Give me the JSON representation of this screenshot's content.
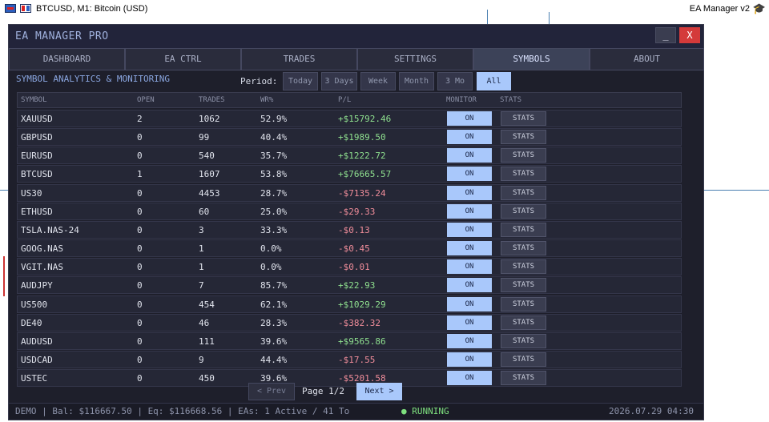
{
  "chart": {
    "title": "BTCUSD, M1:  Bitcoin (USD)",
    "ea_label": "EA Manager v2",
    "icons": [
      "terminal-icon",
      "chart-type-icon",
      "graduation-cap-icon"
    ]
  },
  "panel": {
    "title": "EA MANAGER PRO",
    "minimize_label": "_",
    "close_label": "X"
  },
  "tabs": [
    {
      "label": "DASHBOARD",
      "active": false
    },
    {
      "label": "EA CTRL",
      "active": false
    },
    {
      "label": "TRADES",
      "active": false
    },
    {
      "label": "SETTINGS",
      "active": false
    },
    {
      "label": "SYMBOLS",
      "active": true
    },
    {
      "label": "ABOUT",
      "active": false
    }
  ],
  "section_title": "SYMBOL ANALYTICS & MONITORING",
  "period": {
    "label": "Period:",
    "options": [
      {
        "label": "Today",
        "active": false
      },
      {
        "label": "3 Days",
        "active": false
      },
      {
        "label": "Week",
        "active": false
      },
      {
        "label": "Month",
        "active": false
      },
      {
        "label": "3 Mo",
        "active": false
      },
      {
        "label": "All",
        "active": true
      }
    ]
  },
  "table": {
    "headers": [
      "SYMBOL",
      "OPEN",
      "TRADES",
      "WR%",
      "P/L",
      "MONITOR",
      "STATS"
    ],
    "rows": [
      {
        "symbol": "XAUUSD",
        "open": "2",
        "trades": "1062",
        "wr": "52.9%",
        "pl": "+$15792.46",
        "monitor": "ON",
        "stats": "STATS"
      },
      {
        "symbol": "GBPUSD",
        "open": "0",
        "trades": "99",
        "wr": "40.4%",
        "pl": "+$1989.50",
        "monitor": "ON",
        "stats": "STATS"
      },
      {
        "symbol": "EURUSD",
        "open": "0",
        "trades": "540",
        "wr": "35.7%",
        "pl": "+$1222.72",
        "monitor": "ON",
        "stats": "STATS"
      },
      {
        "symbol": "BTCUSD",
        "open": "1",
        "trades": "1607",
        "wr": "53.8%",
        "pl": "+$76665.57",
        "monitor": "ON",
        "stats": "STATS"
      },
      {
        "symbol": "US30",
        "open": "0",
        "trades": "4453",
        "wr": "28.7%",
        "pl": "-$7135.24",
        "monitor": "ON",
        "stats": "STATS"
      },
      {
        "symbol": "ETHUSD",
        "open": "0",
        "trades": "60",
        "wr": "25.0%",
        "pl": "-$29.33",
        "monitor": "ON",
        "stats": "STATS"
      },
      {
        "symbol": "TSLA.NAS-24",
        "open": "0",
        "trades": "3",
        "wr": "33.3%",
        "pl": "-$0.13",
        "monitor": "ON",
        "stats": "STATS"
      },
      {
        "symbol": "GOOG.NAS",
        "open": "0",
        "trades": "1",
        "wr": "0.0%",
        "pl": "-$0.45",
        "monitor": "ON",
        "stats": "STATS"
      },
      {
        "symbol": "VGIT.NAS",
        "open": "0",
        "trades": "1",
        "wr": "0.0%",
        "pl": "-$0.01",
        "monitor": "ON",
        "stats": "STATS"
      },
      {
        "symbol": "AUDJPY",
        "open": "0",
        "trades": "7",
        "wr": "85.7%",
        "pl": "+$22.93",
        "monitor": "ON",
        "stats": "STATS"
      },
      {
        "symbol": "US500",
        "open": "0",
        "trades": "454",
        "wr": "62.1%",
        "pl": "+$1029.29",
        "monitor": "ON",
        "stats": "STATS"
      },
      {
        "symbol": "DE40",
        "open": "0",
        "trades": "46",
        "wr": "28.3%",
        "pl": "-$382.32",
        "monitor": "ON",
        "stats": "STATS"
      },
      {
        "symbol": "AUDUSD",
        "open": "0",
        "trades": "111",
        "wr": "39.6%",
        "pl": "+$9565.86",
        "monitor": "ON",
        "stats": "STATS"
      },
      {
        "symbol": "USDCAD",
        "open": "0",
        "trades": "9",
        "wr": "44.4%",
        "pl": "-$17.55",
        "monitor": "ON",
        "stats": "STATS"
      },
      {
        "symbol": "USTEC",
        "open": "0",
        "trades": "450",
        "wr": "39.6%",
        "pl": "-$5201.58",
        "monitor": "ON",
        "stats": "STATS"
      }
    ]
  },
  "pagination": {
    "prev_label": "< Prev",
    "page_label": "Page 1/2",
    "next_label": "Next >"
  },
  "status": {
    "left": "DEMO | Bal: $116667.50 | Eq: $116668.56 | EAs: 1 Active / 41 To",
    "running": "● RUNNING",
    "time": "2026.07.29 04:30"
  },
  "colors": {
    "accent": "#a9c8fb",
    "profit": "#8fe08f",
    "loss": "#f08d9a",
    "close": "#d43a3a"
  }
}
